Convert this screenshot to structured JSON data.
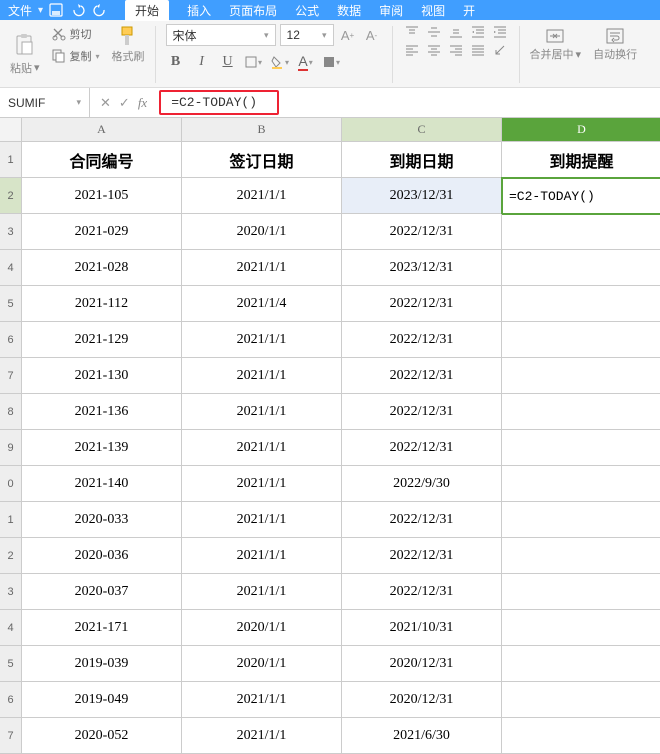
{
  "menubar": {
    "file": "文件",
    "tabs": [
      "开始",
      "插入",
      "页面布局",
      "公式",
      "数据",
      "审阅",
      "视图",
      "开"
    ]
  },
  "ribbon": {
    "paste": "粘贴",
    "cut": "剪切",
    "copy": "复制",
    "format_painter": "格式刷",
    "font_name": "宋体",
    "font_size": "12",
    "merge": "合并居中",
    "wrap": "自动换行"
  },
  "namebox": "SUMIF",
  "formula": "=C2-TODAY()",
  "headers": {
    "A": "合同编号",
    "B": "签订日期",
    "C": "到期日期",
    "D": "到期提醒"
  },
  "rows": [
    {
      "r": "2",
      "A": "2021-105",
      "B": "2021/1/1",
      "C": "2023/12/31",
      "D": "=C2-TODAY()"
    },
    {
      "r": "3",
      "A": "2021-029",
      "B": "2020/1/1",
      "C": "2022/12/31",
      "D": ""
    },
    {
      "r": "4",
      "A": "2021-028",
      "B": "2021/1/1",
      "C": "2023/12/31",
      "D": ""
    },
    {
      "r": "5",
      "A": "2021-112",
      "B": "2021/1/4",
      "C": "2022/12/31",
      "D": ""
    },
    {
      "r": "6",
      "A": "2021-129",
      "B": "2021/1/1",
      "C": "2022/12/31",
      "D": ""
    },
    {
      "r": "7",
      "A": "2021-130",
      "B": "2021/1/1",
      "C": "2022/12/31",
      "D": ""
    },
    {
      "r": "8",
      "A": "2021-136",
      "B": "2021/1/1",
      "C": "2022/12/31",
      "D": ""
    },
    {
      "r": "9",
      "A": "2021-139",
      "B": "2021/1/1",
      "C": "2022/12/31",
      "D": ""
    },
    {
      "r": "0",
      "A": "2021-140",
      "B": "2021/1/1",
      "C": "2022/9/30",
      "D": ""
    },
    {
      "r": "1",
      "A": "2020-033",
      "B": "2021/1/1",
      "C": "2022/12/31",
      "D": ""
    },
    {
      "r": "2",
      "A": "2020-036",
      "B": "2021/1/1",
      "C": "2022/12/31",
      "D": ""
    },
    {
      "r": "3",
      "A": "2020-037",
      "B": "2021/1/1",
      "C": "2022/12/31",
      "D": ""
    },
    {
      "r": "4",
      "A": "2021-171",
      "B": "2020/1/1",
      "C": "2021/10/31",
      "D": ""
    },
    {
      "r": "5",
      "A": "2019-039",
      "B": "2020/1/1",
      "C": "2020/12/31",
      "D": ""
    },
    {
      "r": "6",
      "A": "2019-049",
      "B": "2021/1/1",
      "C": "2020/12/31",
      "D": ""
    },
    {
      "r": "7",
      "A": "2020-052",
      "B": "2021/1/1",
      "C": "2021/6/30",
      "D": ""
    }
  ]
}
